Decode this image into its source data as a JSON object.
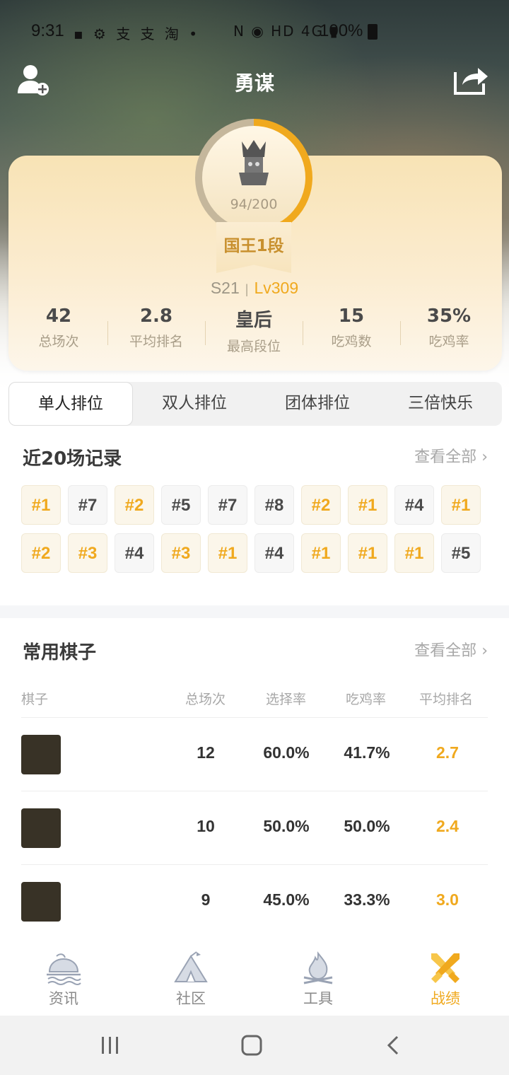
{
  "status_bar": {
    "time": "9:31",
    "left_icons": "▪ ⚙ 支 支 淘 •",
    "right_icons": "N ◉ HD 4G ▮",
    "battery": "100%"
  },
  "header": {
    "title": "勇谋",
    "add_friend_icon": "add-user-icon",
    "share_icon": "share-icon"
  },
  "rank": {
    "progress_text": "94/200",
    "progress_fraction": 0.47,
    "rank_name": "国王1段",
    "season": "S21",
    "level": "Lv309"
  },
  "stats": [
    {
      "value": "42",
      "label": "总场次"
    },
    {
      "value": "2.8",
      "label": "平均排名"
    },
    {
      "value": "皇后",
      "label": "最高段位"
    },
    {
      "value": "15",
      "label": "吃鸡数"
    },
    {
      "value": "35%",
      "label": "吃鸡率"
    }
  ],
  "mode_tabs": [
    {
      "label": "单人排位",
      "active": true
    },
    {
      "label": "双人排位",
      "active": false
    },
    {
      "label": "团体排位",
      "active": false
    },
    {
      "label": "三倍快乐",
      "active": false
    }
  ],
  "recent": {
    "title": "近20场记录",
    "view_all": "查看全部",
    "records": [
      "#1",
      "#7",
      "#2",
      "#5",
      "#7",
      "#8",
      "#2",
      "#1",
      "#4",
      "#1",
      "#2",
      "#3",
      "#4",
      "#3",
      "#1",
      "#4",
      "#1",
      "#1",
      "#1",
      "#5"
    ]
  },
  "pieces": {
    "title": "常用棋子",
    "view_all": "查看全部",
    "headers": {
      "piece": "棋子",
      "total": "总场次",
      "pick_rate": "选择率",
      "win_rate": "吃鸡率",
      "avg_rank": "平均排名"
    },
    "rows": [
      {
        "total": "12",
        "pick_rate": "60.0%",
        "win_rate": "41.7%",
        "avg_rank": "2.7"
      },
      {
        "total": "10",
        "pick_rate": "50.0%",
        "win_rate": "50.0%",
        "avg_rank": "2.4"
      },
      {
        "total": "9",
        "pick_rate": "45.0%",
        "win_rate": "33.3%",
        "avg_rank": "3.0"
      }
    ]
  },
  "bottom_nav": [
    {
      "label": "资讯",
      "icon": "island-icon",
      "active": false
    },
    {
      "label": "社区",
      "icon": "tent-icon",
      "active": false
    },
    {
      "label": "工具",
      "icon": "campfire-icon",
      "active": false
    },
    {
      "label": "战绩",
      "icon": "crossed-swords-icon",
      "active": true
    }
  ],
  "colors": {
    "accent": "#f0a91e",
    "card_bg": "#fbecd0",
    "rank_text": "#c8902e"
  }
}
